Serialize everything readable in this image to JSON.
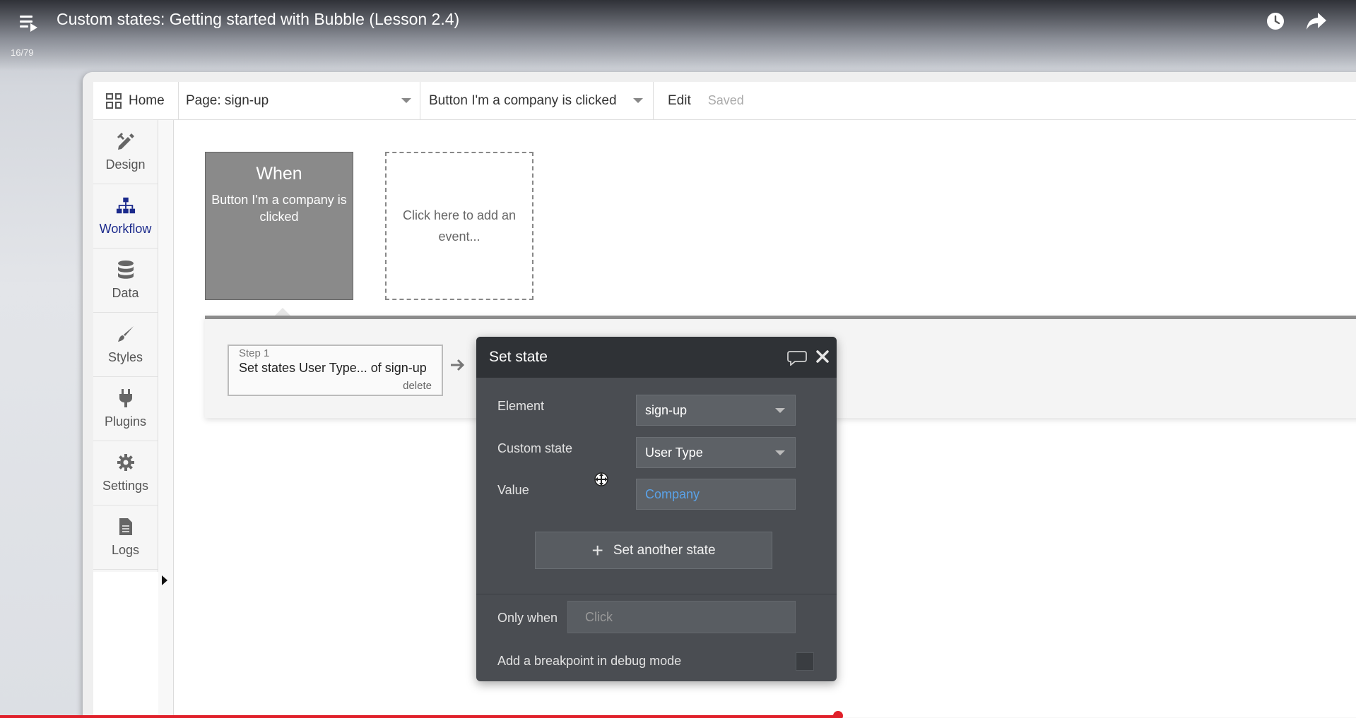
{
  "video": {
    "title": "Custom states: Getting started with Bubble (Lesson 2.4)",
    "counter": "16/79",
    "progress_fraction": 0.618
  },
  "topbar": {
    "home_label": "Home",
    "page_selector": "Page: sign-up",
    "event_selector": "Button I'm a company is clicked",
    "edit_label": "Edit",
    "saved_label": "Saved"
  },
  "sidebar": {
    "items": [
      {
        "label": "Design",
        "icon": "pencil-ruler-icon"
      },
      {
        "label": "Workflow",
        "icon": "workflow-tree-icon"
      },
      {
        "label": "Data",
        "icon": "database-icon"
      },
      {
        "label": "Styles",
        "icon": "brush-icon"
      },
      {
        "label": "Plugins",
        "icon": "plug-icon"
      },
      {
        "label": "Settings",
        "icon": "gear-icon"
      },
      {
        "label": "Logs",
        "icon": "document-icon"
      }
    ],
    "active": "Workflow"
  },
  "canvas": {
    "when_title": "When",
    "when_event": "Button I'm a company is clicked",
    "add_event": "Click here to add an event..."
  },
  "step": {
    "label": "Step 1",
    "text": "Set states User Type... of sign-up",
    "delete_label": "delete"
  },
  "dialog": {
    "title": "Set state",
    "element_label": "Element",
    "element_value": "sign-up",
    "custom_state_label": "Custom state",
    "custom_state_value": "User Type",
    "value_label": "Value",
    "value_value": "Company",
    "set_another_label": "Set another state",
    "only_when_label": "Only when",
    "only_when_placeholder": "Click",
    "breakpoint_label": "Add a breakpoint in debug mode"
  },
  "colors": {
    "accent_workflow": "#1b2a8c",
    "value_link": "#5aa2e8",
    "progress": "#e0202a"
  }
}
